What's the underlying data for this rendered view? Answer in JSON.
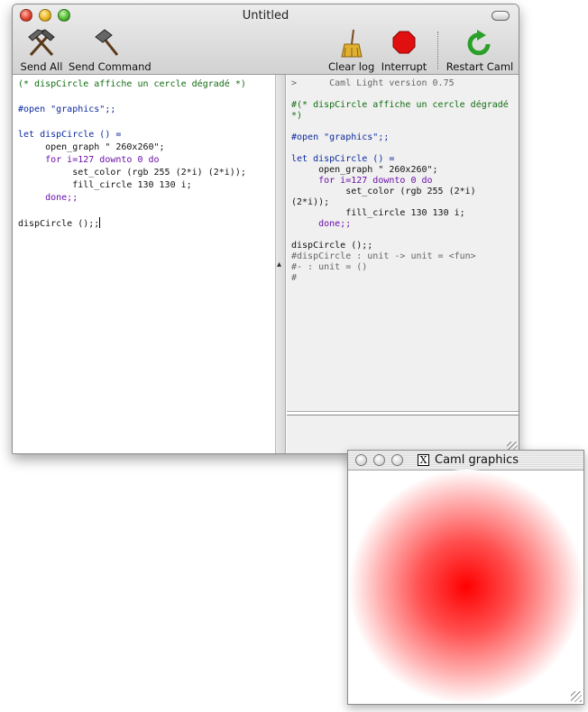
{
  "main_window": {
    "title": "Untitled",
    "toolbar": {
      "send_all": "Send All",
      "send_command": "Send Command",
      "clear_log": "Clear log",
      "interrupt": "Interrupt",
      "restart": "Restart Caml"
    },
    "editor_lines": [
      "(* dispCircle affiche un cercle dégradé *)",
      "",
      "#open \"graphics\";;",
      "",
      "let dispCircle () =",
      "     open_graph \" 260x260\";",
      "     for i=127 downto 0 do",
      "          set_color (rgb 255 (2*i) (2*i));",
      "          fill_circle 130 130 i;",
      "     done;;",
      "",
      "dispCircle ();;"
    ],
    "console_lines": [
      ">      Caml Light version 0.75",
      "",
      "#(* dispCircle affiche un cercle dégradé",
      "*)",
      "",
      "#open \"graphics\";;",
      "",
      "let dispCircle () =",
      "     open_graph \" 260x260\";",
      "     for i=127 downto 0 do",
      "          set_color (rgb 255 (2*i)",
      "(2*i));",
      "          fill_circle 130 130 i;",
      "     done;;",
      "",
      "dispCircle ();;",
      "#dispCircle : unit -> unit = <fun>",
      "#- : unit = ()",
      "#"
    ]
  },
  "graphics_window": {
    "title": "Caml graphics",
    "x_icon": "X",
    "circle_colors": {
      "center": "#ff0000",
      "edge": "#ffffff"
    }
  },
  "icons": {
    "send_all": "hammers-icon",
    "send_command": "hammer-icon",
    "clear_log": "broom-icon",
    "interrupt": "stop-sign-icon",
    "restart": "restart-arrow-icon"
  }
}
